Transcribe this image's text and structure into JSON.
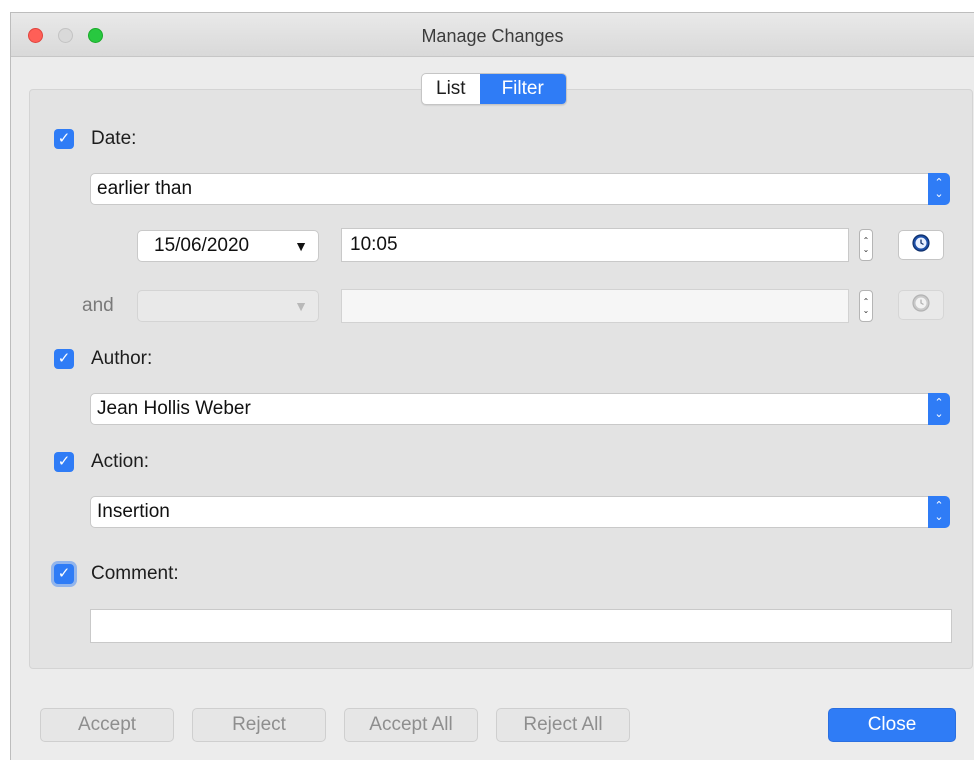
{
  "window": {
    "title": "Manage Changes"
  },
  "tabs": [
    {
      "label": "List",
      "active": false
    },
    {
      "label": "Filter",
      "active": true
    }
  ],
  "filter": {
    "date": {
      "label": "Date:",
      "checked": true,
      "condition": "earlier than",
      "date_value": "15/06/2020",
      "time_value": "10:05",
      "and_label": "and",
      "second_date_value": "",
      "second_time_value": ""
    },
    "author": {
      "label": "Author:",
      "checked": true,
      "value": "Jean Hollis Weber"
    },
    "action": {
      "label": "Action:",
      "checked": true,
      "value": "Insertion"
    },
    "comment": {
      "label": "Comment:",
      "checked": true,
      "value": ""
    }
  },
  "buttons": {
    "accept": "Accept",
    "reject": "Reject",
    "accept_all": "Accept All",
    "reject_all": "Reject All",
    "close": "Close"
  },
  "icons": {
    "checkbox": "checkmark-icon",
    "select": "up-down-chevron-icon",
    "clock": "clock-icon"
  },
  "colors": {
    "accent": "#2f7cf6",
    "window_bg": "#ececec",
    "panel_bg": "#e3e3e3"
  }
}
